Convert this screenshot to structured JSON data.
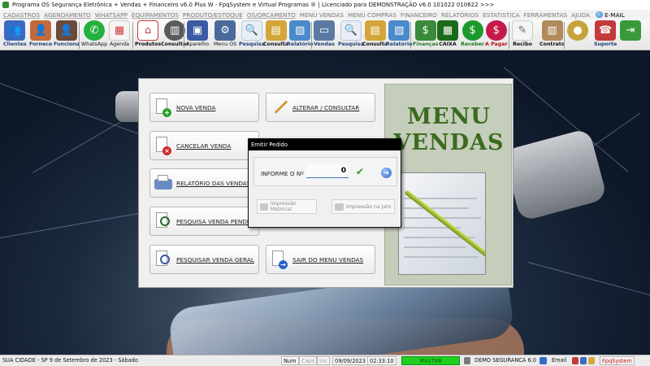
{
  "window": {
    "title": "Programa OS Segurança Eletrônica + Vendas + Financeiro v6.0 Plus W - FpqSystem e Virtual Programas ® | Licenciado para  DEMONSTRAÇÃO v6.0 101022 010622 >>>"
  },
  "menubar": {
    "items": [
      "CADASTROS",
      "AGENDAMENTO",
      "WHATSAPP",
      "EQUIPAMENTOS",
      "PRODUTO/ESTOQUE",
      "OS/ORÇAMENTO",
      "MENU VENDAS",
      "MENU COMPRAS",
      "FINANCEIRO",
      "RELATÓRIOS",
      "ESTATISTICA",
      "FERRAMENTAS",
      "AJUDA"
    ],
    "email": "E-MAIL"
  },
  "toolbar": {
    "items": [
      {
        "label": "Clientes",
        "icon": "users-icon",
        "color": "#3a6bc4"
      },
      {
        "label": "Fornece",
        "icon": "supplier-icon",
        "color": "#c46a3a"
      },
      {
        "label": "Funciona",
        "icon": "employee-icon",
        "color": "#6a4a3a"
      },
      {
        "label": "WhatsApp",
        "icon": "whatsapp-icon",
        "color": "#25b040"
      },
      {
        "label": "Agenda",
        "icon": "calendar-icon",
        "color": "#d23a3a"
      },
      {
        "label": "Produtos",
        "icon": "products-icon",
        "color": "#c43a3a"
      },
      {
        "label": "Consultar",
        "icon": "search-product-icon",
        "color": "#5a5a5a"
      },
      {
        "label": "Aparelho",
        "icon": "device-icon",
        "color": "#3a5aa4"
      },
      {
        "label": "Menu OS",
        "icon": "menu-os-icon",
        "color": "#4a6a9a"
      },
      {
        "label": "Pesquisa",
        "icon": "search-doc-icon",
        "color": "#6a8acb"
      },
      {
        "label": "Consulta",
        "icon": "folder-icon",
        "color": "#d4a63a"
      },
      {
        "label": "Relatório",
        "icon": "report-icon",
        "color": "#4a8acb"
      },
      {
        "label": "Vendas",
        "icon": "sales-icon",
        "color": "#5a7aa4"
      },
      {
        "label": "Pesquisa",
        "icon": "search-sales-icon",
        "color": "#6a8acb"
      },
      {
        "label": "Consulta",
        "icon": "folder-sales-icon",
        "color": "#d4a63a"
      },
      {
        "label": "Relatório",
        "icon": "report-sales-icon",
        "color": "#4a8acb"
      },
      {
        "label": "Finanças",
        "icon": "finance-icon",
        "color": "#3a8a3a"
      },
      {
        "label": "CAIXA",
        "icon": "cashier-icon",
        "color": "#1a6a1a"
      },
      {
        "label": "Receber",
        "icon": "receive-money-icon",
        "color": "#1d9a2d"
      },
      {
        "label": "A Pagar",
        "icon": "pay-money-icon",
        "color": "#c41a4a"
      },
      {
        "label": "Recibo",
        "icon": "receipt-icon",
        "color": "#8a8a8a"
      },
      {
        "label": "Contrato",
        "icon": "contract-icon",
        "color": "#b08a5a"
      },
      {
        "label": "",
        "icon": "coins-icon",
        "color": "#c4a43a"
      },
      {
        "label": "Suporte",
        "icon": "support-icon",
        "color": "#c43a3a"
      },
      {
        "label": "",
        "icon": "exit-icon",
        "color": "#3a9a3a"
      }
    ]
  },
  "panel": {
    "buttons": [
      {
        "label": "NOVA VENDA",
        "icon": "new-sale-icon"
      },
      {
        "label": "ALTERAR / CONSULTAR",
        "icon": "edit-pencil-icon"
      },
      {
        "label": "CANCELAR VENDA",
        "icon": "cancel-sale-icon"
      },
      {
        "label": "RELATÓRIO DAS VENDAS",
        "icon": "printer-icon"
      },
      {
        "label": "PESQUISA VENDA PENDENTE",
        "icon": "pending-search-icon"
      },
      {
        "label": "PESQUISAR VENDA GERAL",
        "icon": "general-search-icon"
      },
      {
        "label": "SAIR DO MENU VENDAS",
        "icon": "exit-menu-icon"
      }
    ],
    "banner": {
      "line1": "MENU",
      "line2": "VENDAS"
    }
  },
  "dialog": {
    "title": "Emitir Pedido",
    "field_label": "INFORME O Nº",
    "field_value": "0",
    "btn_matricial": "Impressão Matricial",
    "btn_jato": "Impressão na Jato"
  },
  "statusbar": {
    "location": "SUA CIDADE - SP  9 de Setembro de 2023 - Sábado",
    "num": "Num",
    "caps": "Caps",
    "ins": "Ins",
    "date": "09/09/2023",
    "time": "02:33:10",
    "master": "MASTER",
    "company": "DEMO SEGURANCA 6.0",
    "email": "Email",
    "brand": "FpqSystem"
  }
}
